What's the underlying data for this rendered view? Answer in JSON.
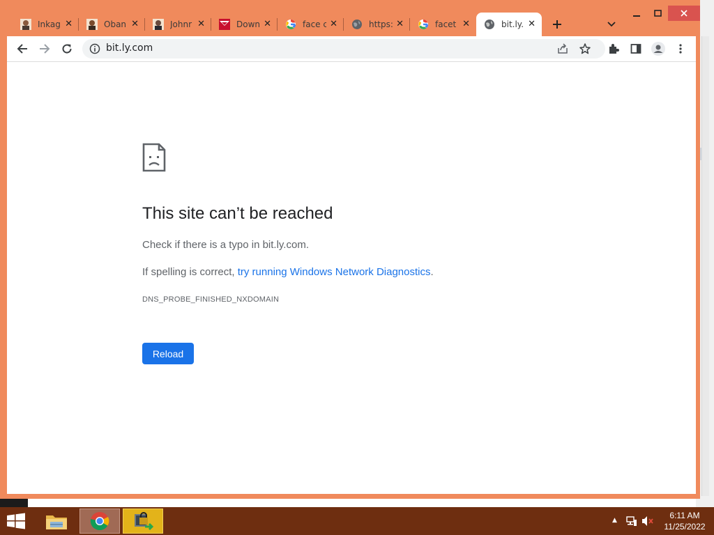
{
  "browser": {
    "tabs": [
      {
        "title": "Inkag",
        "favicon": "avatar-icon"
      },
      {
        "title": "Oban",
        "favicon": "avatar-icon"
      },
      {
        "title": "Johnr",
        "favicon": "avatar-icon"
      },
      {
        "title": "Down",
        "favicon": "red-logo-icon"
      },
      {
        "title": "face c",
        "favicon": "google-icon"
      },
      {
        "title": "https:",
        "favicon": "globe-icon"
      },
      {
        "title": "facet",
        "favicon": "google-icon"
      },
      {
        "title": "bit.ly.",
        "favicon": "globe-icon",
        "active": true
      }
    ],
    "address": "bit.ly.com"
  },
  "error_page": {
    "heading": "This site can’t be reached",
    "line1": "Check if there is a typo in bit.ly.com.",
    "line2_prefix": "If spelling is correct, ",
    "line2_link": "try running Windows Network Diagnostics",
    "line2_suffix": ".",
    "error_code": "DNS_PROBE_FINISHED_NXDOMAIN",
    "reload_label": "Reload"
  },
  "taskbar": {
    "time": "6:11 AM",
    "date": "11/25/2022"
  },
  "colors": {
    "frame": "#f08a5c",
    "taskbar": "#6e2e10",
    "accent": "#1a73e8"
  }
}
